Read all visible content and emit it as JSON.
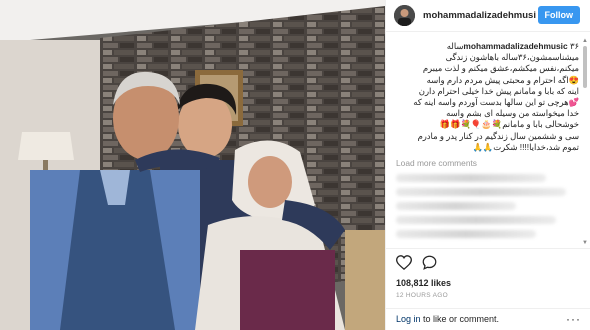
{
  "post": {
    "username": "mohammadalizadehmusi",
    "follow_label": "Follow",
    "caption_user": "mohammadalizadehmusic",
    "caption_lines": [
      "۳۶ساله",
      "میشناسمشون،۳۶ساله باهاشون زندگی",
      "میکنم،نفس میکشم،عشق میکنم و لذت میبرم",
      "😍اگه احترام و محبتی پیش مردم دارم واسه",
      "اینه که بابا و مامانم پیش خدا خیلی احترام دارن",
      "💕هرچی تو این سالها بدست آوردم واسه اینه که",
      "خدا میخواسته من وسیله ای بشم واسه",
      "خوشحالی بابا و مامانم💐🎂🎈💐🎁🎁",
      "سی و ششمین سال زندگیم در کنار پدر و مادرم",
      "تموم شد،خدایا!!!! شکرت🙏🙏"
    ],
    "load_more": "Load more comments",
    "likes": "108,812 likes",
    "time": "12 HOURS AGO",
    "footer_login": "Log in",
    "footer_rest": " to like or comment.",
    "footer_more": "···"
  },
  "icons": {
    "like": "heart-icon",
    "comment": "comment-icon",
    "options": "more-options-icon"
  },
  "colors": {
    "follow_button": "#3897f0",
    "link": "#003569",
    "text": "#262626",
    "muted": "#999999"
  }
}
